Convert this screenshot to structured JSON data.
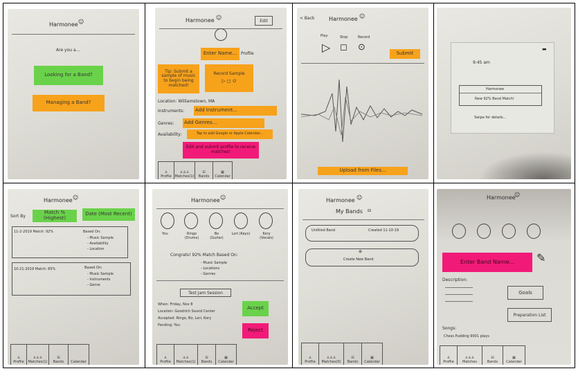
{
  "p1": {
    "title": "Harmonee",
    "prompt": "Are you a...",
    "options": [
      "Looking for a Band?",
      "Managing a Band?"
    ]
  },
  "p2": {
    "title": "Harmonee",
    "edit": "Edit",
    "enter_name": "Enter Name...",
    "profile": "Profile",
    "tip": "Tip: Submit a sample of music to begin being matched!",
    "record_sample": "Record Sample",
    "location": "Location: Williamstown, MA",
    "instruments_label": "Instruments:",
    "instruments_value": "Add Instrument...",
    "genres_label": "Genres:",
    "genres_value": "Add Genres...",
    "availability_label": "Availability:",
    "availability_value": "Tap to add Google or Apple Calendar...",
    "edit_hint": "Edit and submit profile to receive matches!",
    "tabs": [
      "Profile",
      "Matches(1)",
      "Bands",
      "Calendar"
    ]
  },
  "p3": {
    "back": "< Back",
    "title": "Harmonee",
    "controls": [
      "Play",
      "Stop",
      "Record"
    ],
    "submit": "Submit",
    "upload": "Upload from Files..."
  },
  "p4": {
    "time": "9:45 am",
    "notif_title": "Harmonee",
    "notif_body": "New 92% Band Match!",
    "notif_action": "Swipe for details..."
  },
  "p5": {
    "title": "Harmonee",
    "sort_by": "Sort By",
    "sort_options": [
      "Match % (Highest)",
      "Date (Most Recent)"
    ],
    "matches": [
      {
        "head": "11-2-2019 Match: 92%",
        "based": "Based On:",
        "items": [
          "- Music Sample",
          "- Availability",
          "- Location"
        ]
      },
      {
        "head": "10-21-2019 Match: 85%",
        "based": "Based On:",
        "items": [
          "- Music Sample",
          "- Instruments",
          "- Genre"
        ]
      }
    ],
    "tabs": [
      "Profile",
      "Matches(1)",
      "Bands",
      "Calendar"
    ]
  },
  "p6": {
    "title": "Harmonee",
    "members": [
      "You",
      "Ringo (Drums)",
      "Bo (Guitar)",
      "Lori (Keys)",
      "Kory (Vocals)"
    ],
    "congrats": "Congrats! 92% Match Based On:",
    "based_items": [
      "- Music Sample",
      "- Locations",
      "- Genres"
    ],
    "session_title": "Test Jam Session",
    "session_lines": [
      "When: Friday, Nov 8",
      "Location: Goodrich Sound Center",
      "Accepted: Ringo, Bo, Lori, Kory",
      "Pending: You"
    ],
    "accept": "Accept",
    "reject": "Reject",
    "tabs": [
      "Profile",
      "Matches(1)",
      "Bands",
      "Calendar"
    ]
  },
  "p7": {
    "title": "Harmonee",
    "heading": "My Bands",
    "band_name": "Untitled Band",
    "created": "Created 11-10-19",
    "create_new": "Create New Band",
    "tabs": [
      "Profile",
      "Matches(0)",
      "Bands",
      "Calendar"
    ]
  },
  "p8": {
    "title": "Harmonee",
    "enter_band": "Enter Band Name...",
    "description": "Description:",
    "goals": "Goals",
    "prep_list": "Preparation List",
    "songs": "Songs:",
    "song1": "Chess Pudding 9001 plays",
    "tabs": [
      "Profile",
      "Matches",
      "Bands",
      "Calendar"
    ]
  },
  "colors": {
    "green": "#6ad24a",
    "orange": "#f7a21b",
    "pink": "#f21a78",
    "paper": "#e4e3dd"
  }
}
